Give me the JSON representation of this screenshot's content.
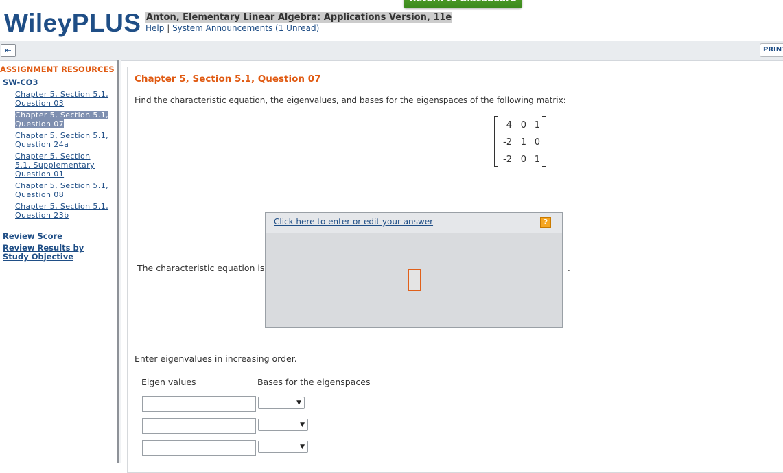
{
  "header": {
    "return_button": "Return to Blackboard",
    "logo": "WileyPLUS",
    "course_title": "Anton, Elementary Linear Algebra: Applications Version, 11e",
    "help_link": "Help",
    "separator": "|",
    "announcements_link": "System Announcements (1 Unread)"
  },
  "toolbar": {
    "collapse_icon": "collapse-sidebar-icon",
    "print_label": "PRINT"
  },
  "sidebar": {
    "heading": "ASSIGNMENT RESOURCES",
    "assignment": "SW-CO3",
    "questions": [
      {
        "label": "Chapter 5, Section 5.1, Question 03",
        "active": false
      },
      {
        "label": "Chapter 5, Section 5.1, Question 07",
        "active": true
      },
      {
        "label": "Chapter 5, Section 5.1, Question 24a",
        "active": false
      },
      {
        "label": "Chapter 5, Section 5.1, Supplementary Question 01",
        "active": false
      },
      {
        "label": "Chapter 5, Section 5.1, Question 08",
        "active": false
      },
      {
        "label": "Chapter 5, Section 5.1, Question 23b",
        "active": false
      }
    ],
    "review_score": "Review Score",
    "review_results": "Review Results by Study Objective"
  },
  "question": {
    "title": "Chapter 5, Section 5.1, Question 07",
    "instructions": "Find the characteristic equation, the eigenvalues, and bases for the eigenspaces of the following matrix:",
    "matrix": [
      [
        "4",
        "0",
        "1"
      ],
      [
        "-2",
        "1",
        "0"
      ],
      [
        "-2",
        "0",
        "1"
      ]
    ],
    "char_label": "The characteristic equation is",
    "answer_link": "Click here to enter or edit your answer",
    "help_icon": "?",
    "period": ".",
    "order_note": "Enter eigenvalues in increasing order.",
    "col_eigen": "Eigen values",
    "col_bases": "Bases for the eigenspaces",
    "rows": [
      {
        "eigenvalue": "",
        "basis": ""
      },
      {
        "eigenvalue": "",
        "basis": ""
      },
      {
        "eigenvalue": "",
        "basis": ""
      }
    ]
  },
  "colors": {
    "brand_blue": "#1f4e86",
    "accent_orange": "#e05a12",
    "return_green": "#4a9a25"
  }
}
